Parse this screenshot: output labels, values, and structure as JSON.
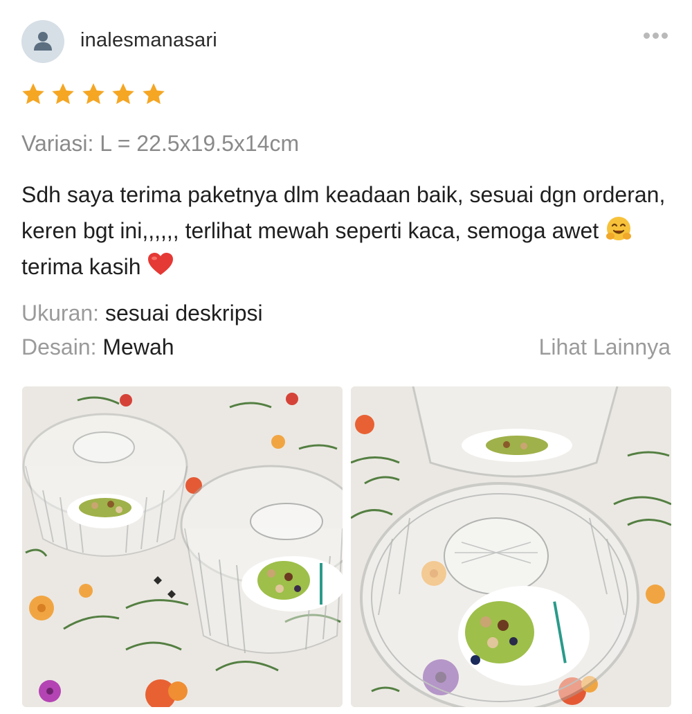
{
  "review": {
    "username": "inalesmanasari",
    "rating": 5,
    "rating_max": 5,
    "variation": "Variasi: L = 22.5x19.5x14cm",
    "text_parts": [
      "Sdh saya terima paketnya dlm keadaan baik, sesuai dgn orderan, keren bgt ini,,,,,, terlihat mewah seperti kaca, semoga awet",
      "terima kasih"
    ],
    "emoji_icons": [
      "hugging-face-emoji",
      "red-heart-emoji"
    ],
    "attributes": [
      {
        "key": "Ukuran:",
        "value": "sesuai deskripsi"
      },
      {
        "key": "Desain:",
        "value": "Mewah"
      }
    ],
    "see_more_label": "Lihat Lainnya",
    "photos": [
      {
        "description_icon": "product-photo"
      },
      {
        "description_icon": "product-photo"
      }
    ]
  },
  "colors": {
    "star": "#f5a623",
    "secondary_text": "#9a9a9a",
    "primary_text": "#1f1f1f",
    "avatar_bg": "#d6dfe6"
  },
  "icons": [
    "user-avatar-icon",
    "more-options-icon",
    "star-icon"
  ]
}
